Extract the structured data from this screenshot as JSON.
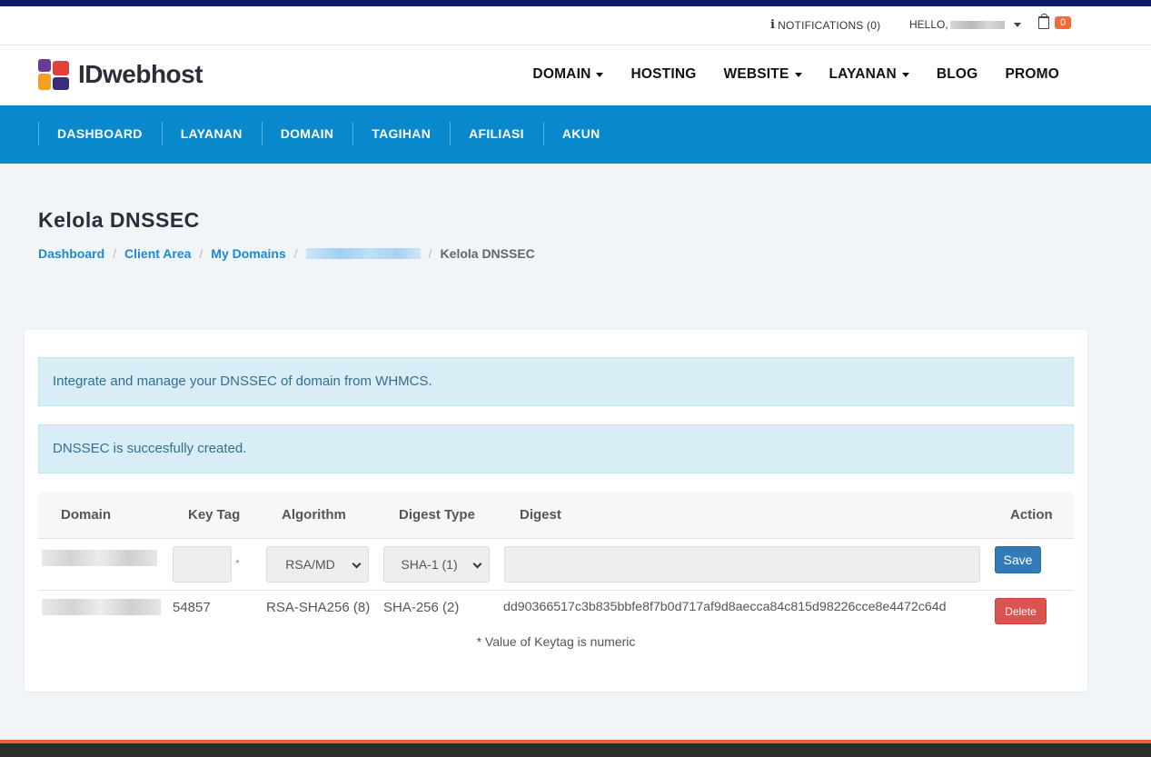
{
  "topbar": {
    "notifications_label": "NOTIFICATIONS (0)",
    "hello_label": "HELLO,",
    "cart_count": "0"
  },
  "brand": {
    "name": "IDwebhost"
  },
  "main_nav": [
    {
      "label": "DOMAIN",
      "dropdown": true
    },
    {
      "label": "HOSTING",
      "dropdown": false
    },
    {
      "label": "WEBSITE",
      "dropdown": true
    },
    {
      "label": "LAYANAN",
      "dropdown": true
    },
    {
      "label": "BLOG",
      "dropdown": false
    },
    {
      "label": "PROMO",
      "dropdown": false
    }
  ],
  "sub_nav": [
    "DASHBOARD",
    "LAYANAN",
    "DOMAIN",
    "TAGIHAN",
    "AFILIASI",
    "AKUN"
  ],
  "page": {
    "title": "Kelola DNSSEC",
    "breadcrumb": [
      "Dashboard",
      "Client Area",
      "My Domains",
      "Kelola DNSSEC"
    ]
  },
  "alerts": {
    "info": "Integrate and manage your DNSSEC of domain from WHMCS.",
    "success": "DNSSEC is succesfully created."
  },
  "table": {
    "headers": [
      "Domain",
      "Key Tag",
      "Algorithm",
      "Digest Type",
      "Digest",
      "Action"
    ],
    "form_row": {
      "keytag_value": "",
      "asterisk": "*",
      "algorithm_selected": "RSA/MD",
      "digest_type_selected": "SHA-1 (1)",
      "digest_value": "",
      "save_label": "Save"
    },
    "records": [
      {
        "key_tag": "54857",
        "algorithm": "RSA-SHA256 (8)",
        "digest_type": "SHA-256 (2)",
        "digest": "dd90366517c3b835bbfe8f7b0d717af9d8aecca84c815d98226cce8e4472c64d",
        "delete_label": "Delete"
      }
    ],
    "note": "* Value of Keytag is numeric"
  },
  "colors": {
    "brand_blue": "#0a88cc",
    "link_blue": "#1a8ad4",
    "save_blue": "#337ab7",
    "delete_red": "#d9534f",
    "alert_bg": "#d9edf7",
    "cart_badge": "#f16a3a"
  }
}
